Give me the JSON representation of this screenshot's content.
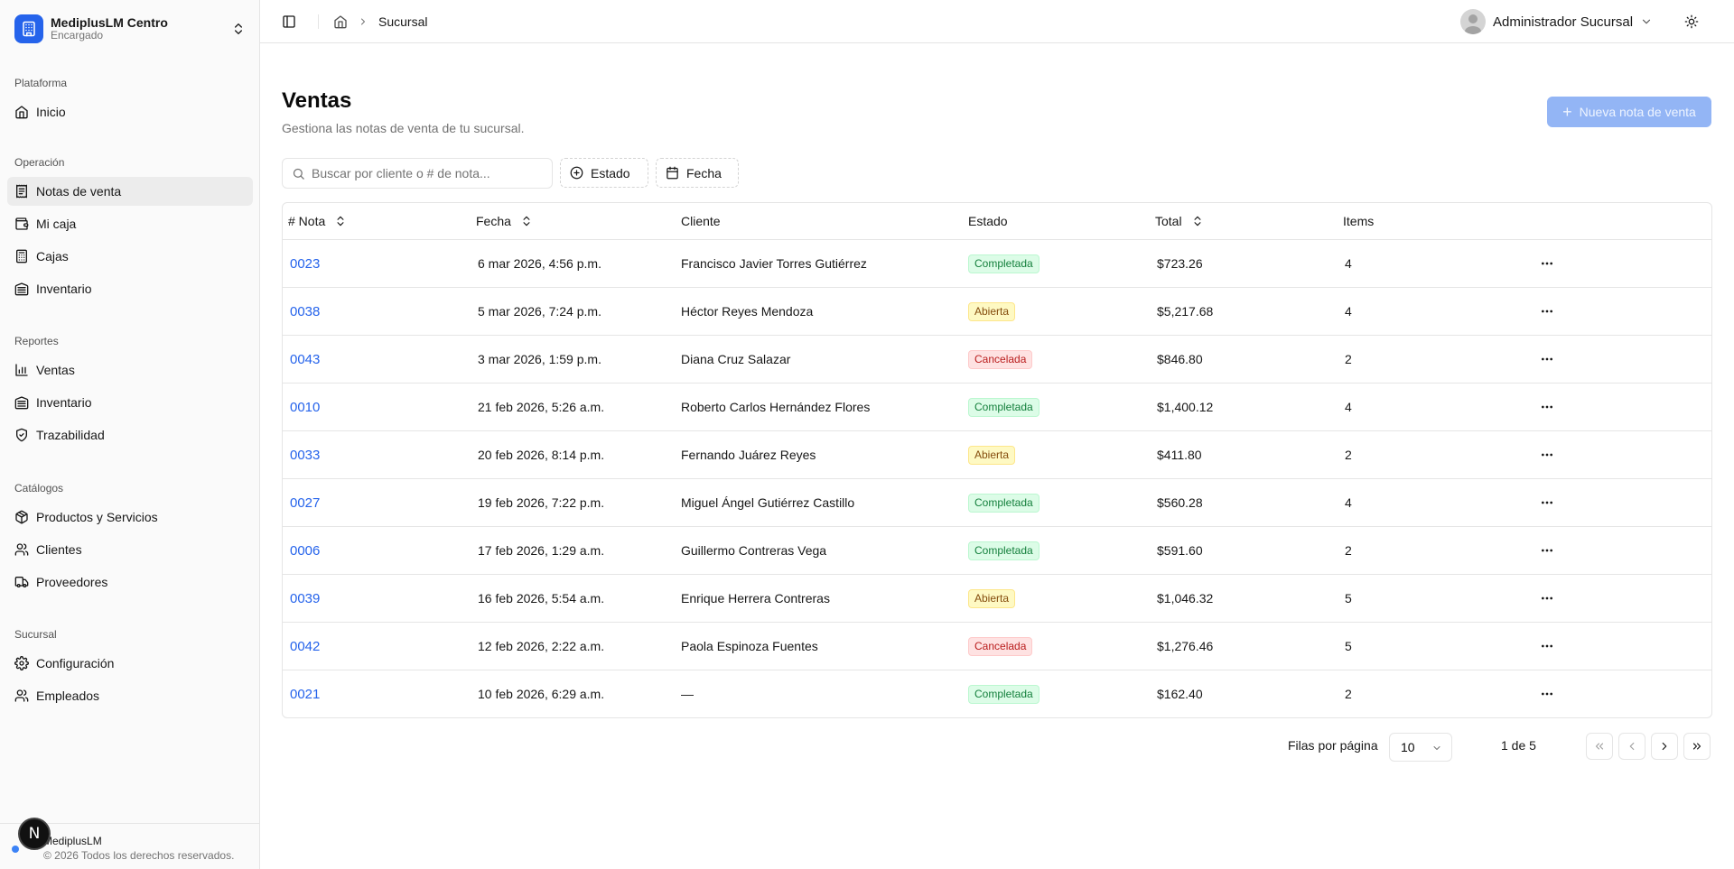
{
  "org": {
    "name": "MediplusLM Centro",
    "role": "Encargado"
  },
  "nav": [
    {
      "label": "Plataforma",
      "items": [
        {
          "label": "Inicio",
          "icon": "home-icon"
        }
      ]
    },
    {
      "label": "Operación",
      "items": [
        {
          "label": "Notas de venta",
          "icon": "receipt-icon",
          "active": true
        },
        {
          "label": "Mi caja",
          "icon": "wallet-icon"
        },
        {
          "label": "Cajas",
          "icon": "calculator-icon"
        },
        {
          "label": "Inventario",
          "icon": "warehouse-icon"
        }
      ]
    },
    {
      "label": "Reportes",
      "items": [
        {
          "label": "Ventas",
          "icon": "bar-chart-icon"
        },
        {
          "label": "Inventario",
          "icon": "warehouse-icon"
        },
        {
          "label": "Trazabilidad",
          "icon": "shield-check-icon"
        }
      ]
    },
    {
      "label": "Catálogos",
      "items": [
        {
          "label": "Productos y Servicios",
          "icon": "package-icon"
        },
        {
          "label": "Clientes",
          "icon": "users-icon"
        },
        {
          "label": "Proveedores",
          "icon": "truck-icon"
        }
      ]
    },
    {
      "label": "Sucursal",
      "items": [
        {
          "label": "Configuración",
          "icon": "gear-icon"
        },
        {
          "label": "Empleados",
          "icon": "users-icon"
        }
      ]
    }
  ],
  "footer": {
    "line1": "MediplusLM",
    "line2": "© 2026 Todos los derechos reservados.",
    "badge": "N"
  },
  "header": {
    "breadcrumb": "Sucursal",
    "user": "Administrador Sucursal"
  },
  "page": {
    "title": "Ventas",
    "subtitle": "Gestiona las notas de venta de tu sucursal.",
    "new_button": "Nueva nota de venta"
  },
  "filters": {
    "search_placeholder": "Buscar por cliente o # de nota...",
    "estado": "Estado",
    "fecha": "Fecha"
  },
  "table": {
    "columns": [
      "# Nota",
      "Fecha",
      "Cliente",
      "Estado",
      "Total",
      "Items"
    ],
    "rows": [
      {
        "nota": "0023",
        "fecha": "6 mar 2026, 4:56 p.m.",
        "cliente": "Francisco Javier Torres Gutiérrez",
        "estado": "Completada",
        "total": "$723.26",
        "items": "4"
      },
      {
        "nota": "0038",
        "fecha": "5 mar 2026, 7:24 p.m.",
        "cliente": "Héctor Reyes Mendoza",
        "estado": "Abierta",
        "total": "$5,217.68",
        "items": "4"
      },
      {
        "nota": "0043",
        "fecha": "3 mar 2026, 1:59 p.m.",
        "cliente": "Diana Cruz Salazar",
        "estado": "Cancelada",
        "total": "$846.80",
        "items": "2"
      },
      {
        "nota": "0010",
        "fecha": "21 feb 2026, 5:26 a.m.",
        "cliente": "Roberto Carlos Hernández Flores",
        "estado": "Completada",
        "total": "$1,400.12",
        "items": "4"
      },
      {
        "nota": "0033",
        "fecha": "20 feb 2026, 8:14 p.m.",
        "cliente": "Fernando Juárez Reyes",
        "estado": "Abierta",
        "total": "$411.80",
        "items": "2"
      },
      {
        "nota": "0027",
        "fecha": "19 feb 2026, 7:22 p.m.",
        "cliente": "Miguel Ángel Gutiérrez Castillo",
        "estado": "Completada",
        "total": "$560.28",
        "items": "4"
      },
      {
        "nota": "0006",
        "fecha": "17 feb 2026, 1:29 a.m.",
        "cliente": "Guillermo Contreras Vega",
        "estado": "Completada",
        "total": "$591.60",
        "items": "2"
      },
      {
        "nota": "0039",
        "fecha": "16 feb 2026, 5:54 a.m.",
        "cliente": "Enrique Herrera Contreras",
        "estado": "Abierta",
        "total": "$1,046.32",
        "items": "5"
      },
      {
        "nota": "0042",
        "fecha": "12 feb 2026, 2:22 a.m.",
        "cliente": "Paola Espinoza Fuentes",
        "estado": "Cancelada",
        "total": "$1,276.46",
        "items": "5"
      },
      {
        "nota": "0021",
        "fecha": "10 feb 2026, 6:29 a.m.",
        "cliente": "—",
        "estado": "Completada",
        "total": "$162.40",
        "items": "2"
      }
    ]
  },
  "pagination": {
    "rows_label": "Filas por página",
    "rows_value": "10",
    "page_info": "1 de 5"
  },
  "colors": {
    "accent": "#2563eb",
    "button_disabled": "#93b5f5"
  }
}
